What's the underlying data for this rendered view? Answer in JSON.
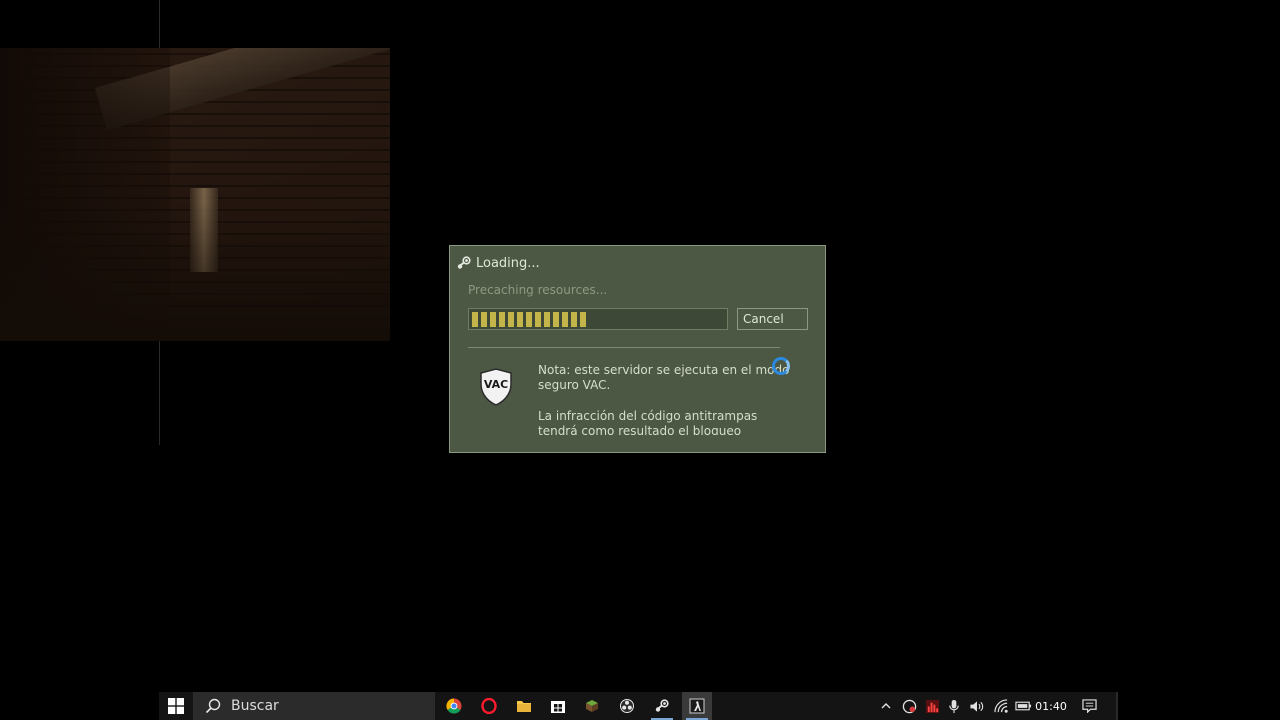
{
  "dialog": {
    "title": "Loading...",
    "status": "Precaching resources...",
    "progress_segments_filled": 13,
    "cancel_label": "Cancel",
    "note_line1": "Nota: este servidor se ejecuta en el modo seguro VAC.",
    "note_line2": "La infracción del código antitrampas tendrá como resultado el bloqueo permanente",
    "vac_badge": "VAC"
  },
  "taskbar": {
    "search_placeholder": "Buscar",
    "apps": [
      "chrome-icon",
      "opera-icon",
      "file-explorer-icon",
      "store-icon",
      "minecraft-icon",
      "obs-icon",
      "steam-icon",
      "cs-icon"
    ],
    "active_app": "cs-icon",
    "clock": "01:40"
  },
  "colors": {
    "dialog_bg": "#4c5844",
    "progress_fill": "#c4b54a",
    "taskbar_bg": "#141414"
  }
}
